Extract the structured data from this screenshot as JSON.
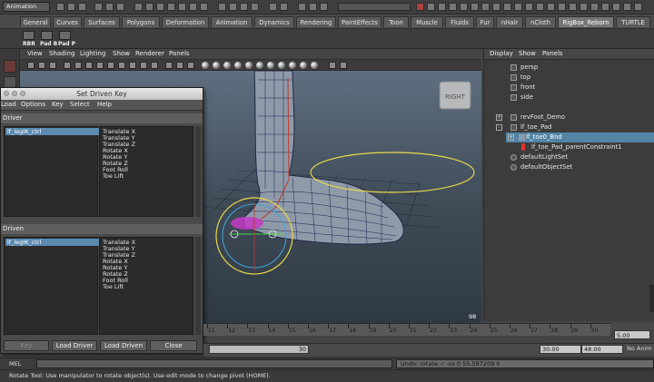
{
  "topbar": {
    "mode": "Animation"
  },
  "shelf_tabs": [
    {
      "label": "General"
    },
    {
      "label": "Curves"
    },
    {
      "label": "Surfaces"
    },
    {
      "label": "Polygons"
    },
    {
      "label": "Deformation"
    },
    {
      "label": "Animation"
    },
    {
      "label": "Dynamics"
    },
    {
      "label": "Rendering"
    },
    {
      "label": "PaintEffects"
    },
    {
      "label": "Toon"
    },
    {
      "label": "Muscle"
    },
    {
      "label": "Fluids"
    },
    {
      "label": "Fur"
    },
    {
      "label": "nHair"
    },
    {
      "label": "nCloth"
    },
    {
      "label": "RigBox_Reborn"
    },
    {
      "label": "TURTLE"
    }
  ],
  "shelf": {
    "buttons": [
      "RBR",
      "Pad B",
      "Pad P"
    ]
  },
  "viewport": {
    "menu": [
      "View",
      "Shading",
      "Lighting",
      "Show",
      "Renderer",
      "Panels"
    ],
    "view_cube": "RIGHT",
    "corner_number": "98"
  },
  "outliner": {
    "menu": [
      "Display",
      "Show",
      "Panels"
    ],
    "items": [
      {
        "label": "persp"
      },
      {
        "label": "top"
      },
      {
        "label": "front"
      },
      {
        "label": "side"
      },
      {
        "label": "revFoot_Demo"
      },
      {
        "label": "lf_toe_Pad"
      },
      {
        "label": "lf_toe0_Bnd"
      },
      {
        "label": "lf_toe_Pad_parentConstraint1"
      },
      {
        "label": "defaultLightSet"
      },
      {
        "label": "defaultObjectSet"
      }
    ]
  },
  "sdk": {
    "title": "Set Driven Key",
    "menu": [
      "Load",
      "Options",
      "Key",
      "Select",
      "Help"
    ],
    "driver": {
      "header": "Driver",
      "object": "lf_legIK_ctrl",
      "attributes": [
        "Translate X",
        "Translate Y",
        "Translate Z",
        "Rotate X",
        "Rotate Y",
        "Rotate Z",
        "Foot Roll",
        "Toe Lift"
      ]
    },
    "driven": {
      "header": "Driven",
      "object": "lf_legIK_ctrl",
      "attributes": [
        "Translate X",
        "Translate Y",
        "Translate Z",
        "Rotate X",
        "Rotate Y",
        "Rotate Z",
        "Foot Roll",
        "Toe Lift"
      ]
    },
    "buttons": {
      "key": "Key",
      "load_driver": "Load Driver",
      "load_driven": "Load Driven",
      "close": "Close"
    }
  },
  "timeline": {
    "ticks": [
      "11",
      "12",
      "13",
      "14",
      "15",
      "16",
      "17",
      "18",
      "19",
      "20",
      "21",
      "22",
      "23",
      "24",
      "25",
      "26",
      "27",
      "28",
      "29",
      "30"
    ],
    "current_frame": "5.00",
    "range_end_shown": "30",
    "playback_end": "30.00",
    "anim_end": "48.00",
    "no_anim": "No Anim"
  },
  "command": {
    "label": "MEL",
    "result": "Undo: rotate -r -os 0 55.597209 0"
  },
  "helpline": "Rotate Tool: Use manipulator to rotate object(s). Use edit mode to change pivot (HOME).",
  "colors": {
    "selection": "#5285a6",
    "title_bar": "#d4d4d4",
    "viewport_bg": "#4e5c6a"
  }
}
